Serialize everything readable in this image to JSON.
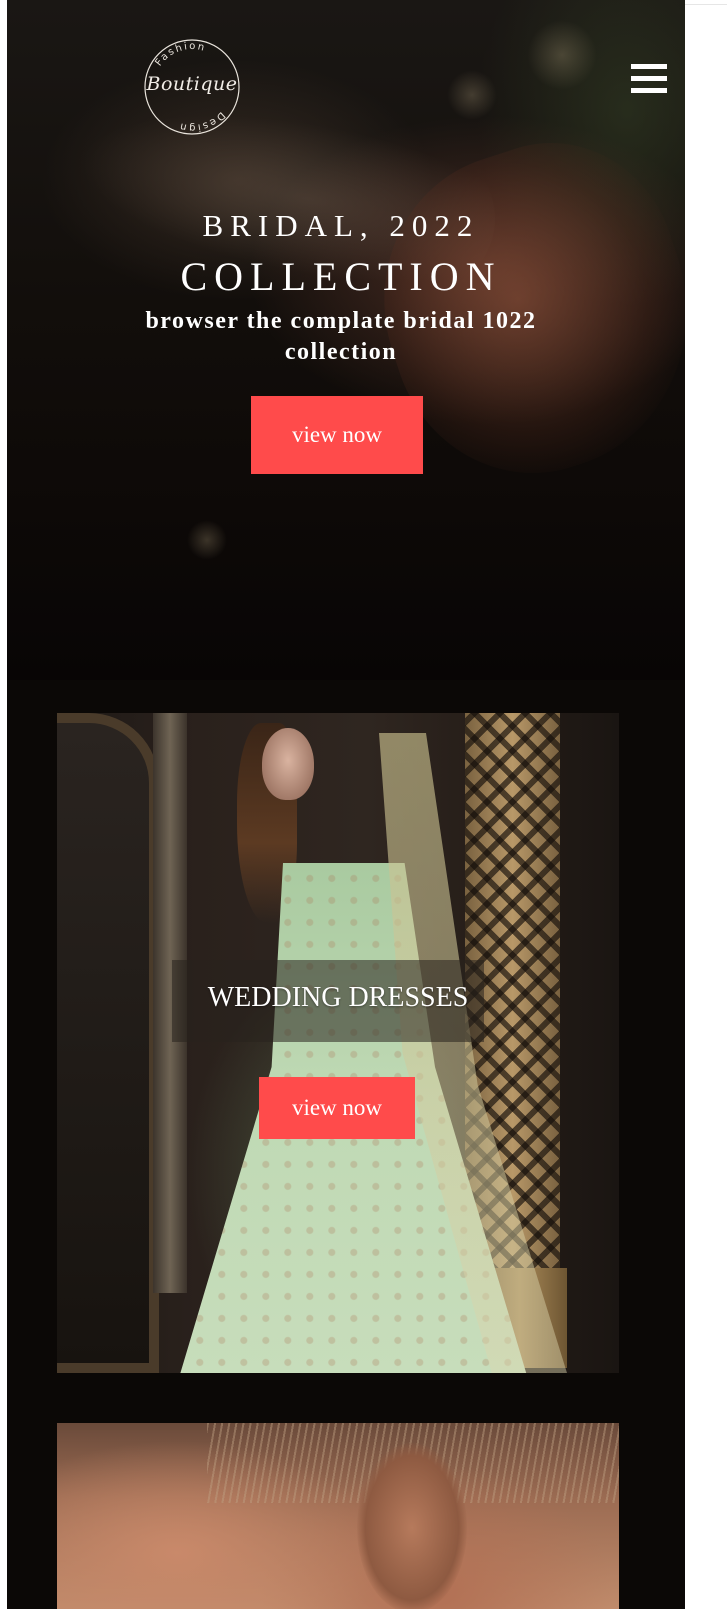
{
  "header": {
    "logo": {
      "top_text": "Fashion",
      "main_text": "Boutique",
      "bottom_text": "Design"
    },
    "menu_icon": "hamburger-menu-icon"
  },
  "hero": {
    "eyebrow": "BRIDAL, 2022",
    "title": "COLLECTION",
    "subtitle": "browser the complate bridal 1022 collection",
    "button_label": "view now"
  },
  "categories": [
    {
      "label": "WEDDING DRESSES",
      "button_label": "view now"
    }
  ],
  "colors": {
    "accent": "#ff4b4b",
    "page_background": "#0b0806",
    "text": "#ffffff"
  }
}
